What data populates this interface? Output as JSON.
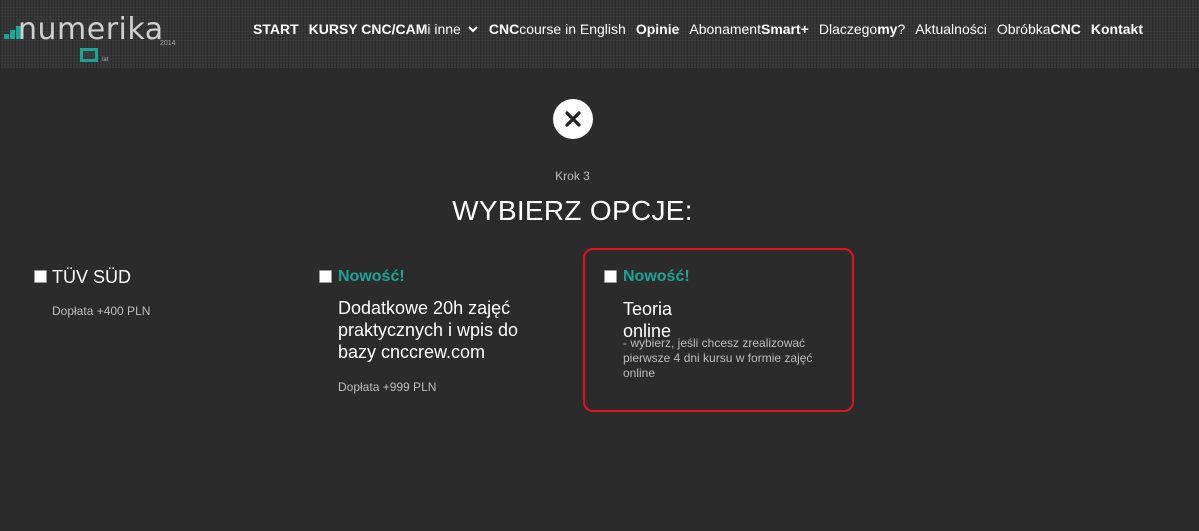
{
  "logo": {
    "word": "numerika",
    "year": "2014",
    "suffix": "lat"
  },
  "nav": {
    "start": "START",
    "kursy_bold": "KURSY CNC/CAM",
    "kursy_light": " i inne",
    "cnc_bold": "CNC",
    "cnc_light": " course in English",
    "opinie": "Opinie",
    "abonament_light": "Abonament ",
    "abonament_bold": "Smart+",
    "dlaczego_light": "Dlaczego ",
    "dlaczego_bold": "my",
    "dlaczego_q": "?",
    "aktualnosci": "Aktualności",
    "obrobka_light": "Obróbka ",
    "obrobka_bold": "CNC",
    "kontakt": "Kontakt"
  },
  "modal": {
    "step": "Krok 3",
    "title": "WYBIERZ OPCJE:"
  },
  "options": [
    {
      "name": "TÜV SÜD",
      "price": "Dopłata +400 PLN"
    },
    {
      "tag": "Nowość!",
      "name": "Dodatkowe 20h zajęć praktycznych i wpis do bazy cnccrew.com",
      "price": "Dopłata +999 PLN"
    },
    {
      "tag": "Nowość!",
      "name": "Teoria online",
      "desc": "- wybierz, jeśli chcesz zrealizować pierwsze 4 dni kursu w formie zajęć online"
    }
  ],
  "colors": {
    "background": "#2b2b2b",
    "accent": "#1aa596",
    "highlight": "#e0141e"
  },
  "icons": {
    "close": "close-icon",
    "dropdown": "chevron-down-icon"
  }
}
